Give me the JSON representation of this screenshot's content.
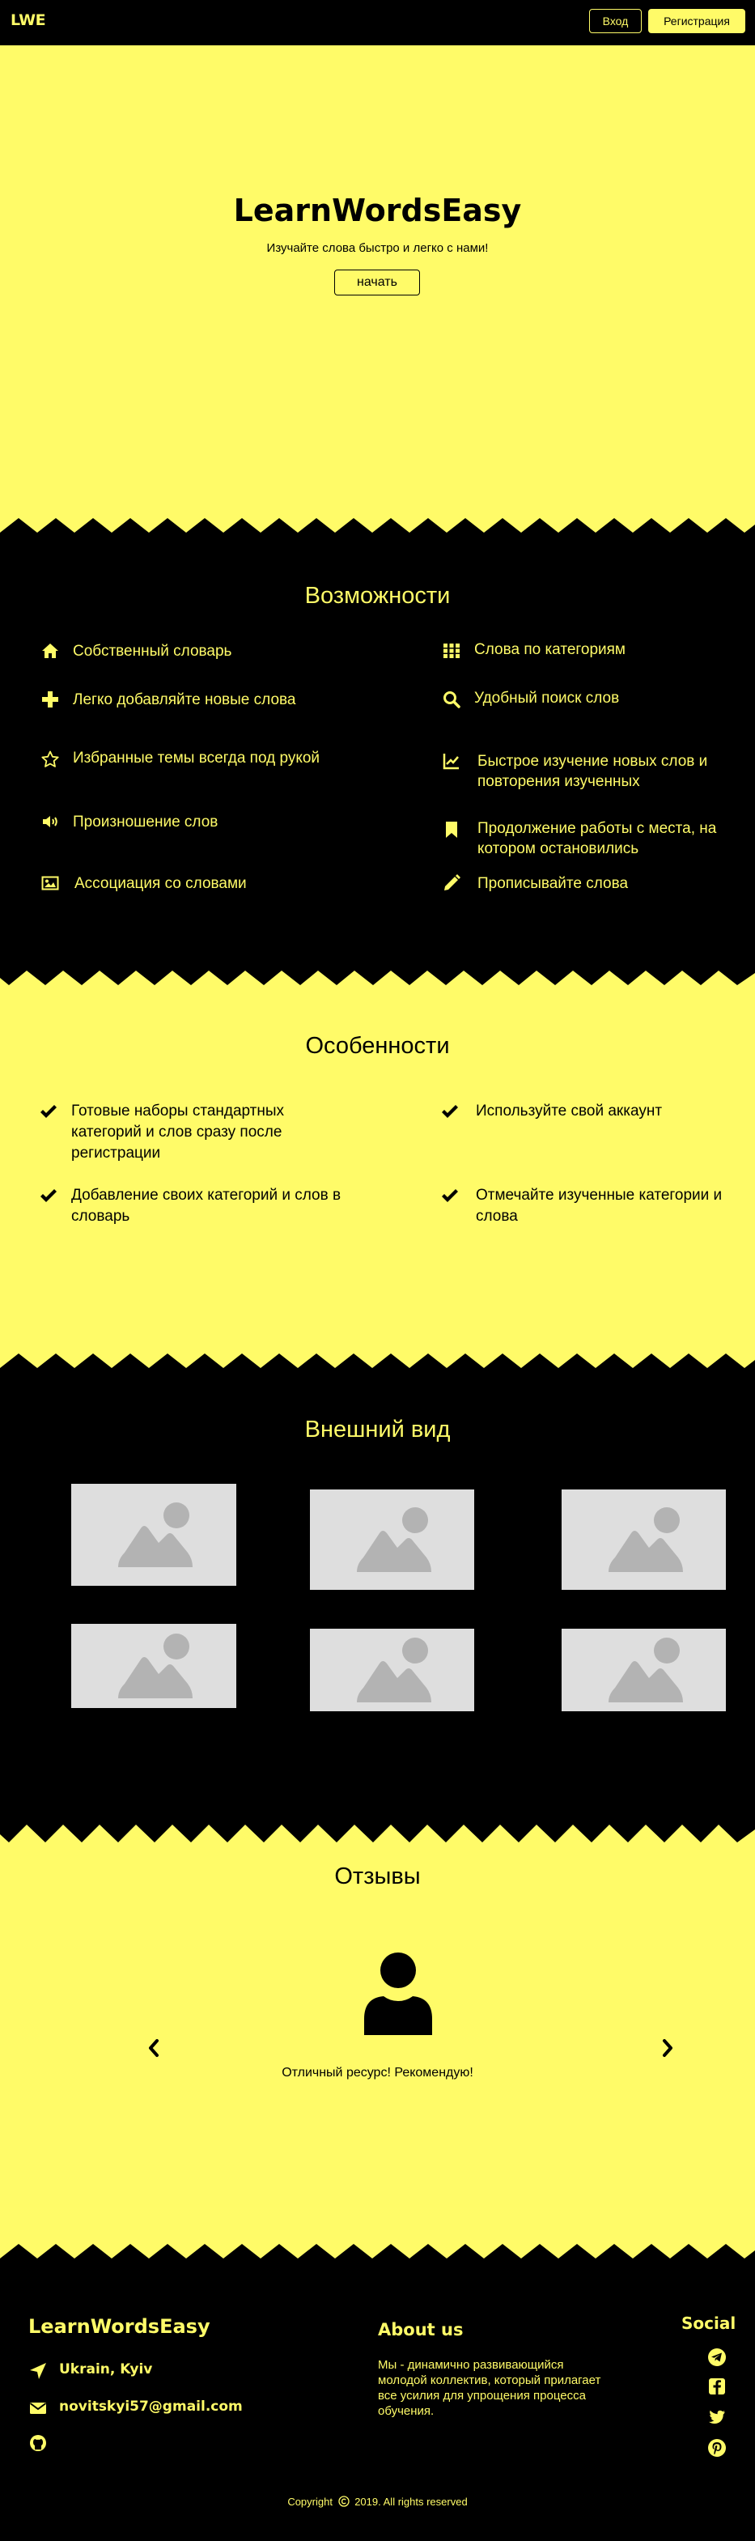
{
  "nav": {
    "logo": "LWE",
    "login_label": "Вход",
    "register_label": "Регистрация"
  },
  "hero": {
    "title": "LearnWordsEasy",
    "subtitle": "Изучайте слова быстро и легко с нами!",
    "start_label": "начать"
  },
  "features": {
    "title": "Возможности",
    "items": [
      {
        "icon": "home-icon",
        "label": "Собственный словарь"
      },
      {
        "icon": "grid-icon",
        "label": "Слова по категориям"
      },
      {
        "icon": "plus-icon",
        "label": "Легко добавляйте новые слова"
      },
      {
        "icon": "search-icon",
        "label": "Удобный поиск слов"
      },
      {
        "icon": "star-icon",
        "label": "Избранные темы всегда под рукой"
      },
      {
        "icon": "chart-line-icon",
        "label": "Быстрое изучение новых слов и повторения изученных"
      },
      {
        "icon": "volume-icon",
        "label": "Произношение слов"
      },
      {
        "icon": "bookmark-icon",
        "label": "Продолжение работы с места, на котором остановились"
      },
      {
        "icon": "image-icon",
        "label": "Ассоциация со словами"
      },
      {
        "icon": "pencil-icon",
        "label": "Прописывайте слова"
      }
    ]
  },
  "peculiarities": {
    "title": "Особенности",
    "items": [
      {
        "label": "Готовые наборы стандартных категорий и слов сразу после регистрации"
      },
      {
        "label": "Используйте свой аккаунт"
      },
      {
        "label": "Добавление своих категорий и слов в словарь"
      },
      {
        "label": "Отмечайте изученные категории и слова"
      }
    ]
  },
  "appearance": {
    "title": "Внешний вид",
    "images": [
      "image-placeholder-icon",
      "image-placeholder-icon",
      "image-placeholder-icon",
      "image-placeholder-icon",
      "image-placeholder-icon",
      "image-placeholder-icon"
    ]
  },
  "reviews": {
    "title": "Отзывы",
    "text": "Отличный ресурс! Рекомендую!",
    "avatar_icon": "user-icon"
  },
  "footer": {
    "name": "LearnWordsEasy",
    "location": "Ukrain, Kyiv",
    "email": "novitskyi57@gmail.com",
    "about_title": "About us",
    "about_text": "Мы - динамично развивающийся молодой коллектив, который прилагает все усилия для упрощения процесса обучения.",
    "social_title": "Social",
    "social_icons": [
      "telegram-icon",
      "facebook-icon",
      "twitter-icon",
      "pinterest-icon"
    ],
    "copyright_prefix": "Copyright",
    "copyright_suffix": "2019. All rights reserved"
  },
  "colors": {
    "accent": "#fffb68",
    "dark": "#000000"
  }
}
